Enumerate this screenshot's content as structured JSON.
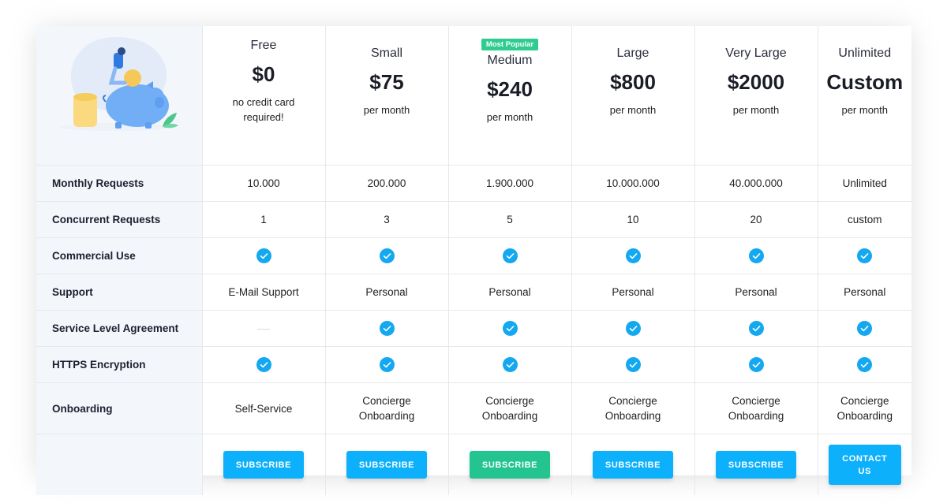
{
  "illustration": {
    "description": "piggy-bank-illustration"
  },
  "colors": {
    "accent": "#0db0fb",
    "popular": "#23c490",
    "check": "#14a8f0",
    "label_bg": "#f3f6fa"
  },
  "plans": [
    {
      "name": "Free",
      "price": "$0",
      "sub_line1": "no credit card",
      "sub_line2": "required!",
      "badge": null
    },
    {
      "name": "Small",
      "price": "$75",
      "sub_line1": "per month",
      "sub_line2": "",
      "badge": null
    },
    {
      "name": "Medium",
      "price": "$240",
      "sub_line1": "per month",
      "sub_line2": "",
      "badge": "Most Popular"
    },
    {
      "name": "Large",
      "price": "$800",
      "sub_line1": "per month",
      "sub_line2": "",
      "badge": null
    },
    {
      "name": "Very Large",
      "price": "$2000",
      "sub_line1": "per month",
      "sub_line2": "",
      "badge": null
    },
    {
      "name": "Unlimited",
      "price": "Custom",
      "sub_line1": "per month",
      "sub_line2": "",
      "badge": null
    }
  ],
  "features": [
    {
      "label": "Monthly Requests",
      "values": [
        "10.000",
        "200.000",
        "1.900.000",
        "10.000.000",
        "40.000.000",
        "Unlimited"
      ]
    },
    {
      "label": "Concurrent Requests",
      "values": [
        "1",
        "3",
        "5",
        "10",
        "20",
        "custom"
      ]
    },
    {
      "label": "Commercial Use",
      "values": [
        "check",
        "check",
        "check",
        "check",
        "check",
        "check"
      ]
    },
    {
      "label": "Support",
      "values": [
        "E-Mail Support",
        "Personal",
        "Personal",
        "Personal",
        "Personal",
        "Personal"
      ]
    },
    {
      "label": "Service Level Agreement",
      "values": [
        "none",
        "check",
        "check",
        "check",
        "check",
        "check"
      ]
    },
    {
      "label": "HTTPS Encryption",
      "values": [
        "check",
        "check",
        "check",
        "check",
        "check",
        "check"
      ]
    },
    {
      "label": "Onboarding",
      "values": [
        [
          "Self-Service"
        ],
        [
          "Concierge",
          "Onboarding"
        ],
        [
          "Concierge",
          "Onboarding"
        ],
        [
          "Concierge",
          "Onboarding"
        ],
        [
          "Concierge",
          "Onboarding"
        ],
        [
          "Concierge",
          "Onboarding"
        ]
      ]
    }
  ],
  "buttons": [
    {
      "label_line1": "SUBSCRIBE",
      "label_line2": ""
    },
    {
      "label_line1": "SUBSCRIBE",
      "label_line2": ""
    },
    {
      "label_line1": "SUBSCRIBE",
      "label_line2": ""
    },
    {
      "label_line1": "SUBSCRIBE",
      "label_line2": ""
    },
    {
      "label_line1": "SUBSCRIBE",
      "label_line2": ""
    },
    {
      "label_line1": "CONTACT",
      "label_line2": "US"
    }
  ]
}
